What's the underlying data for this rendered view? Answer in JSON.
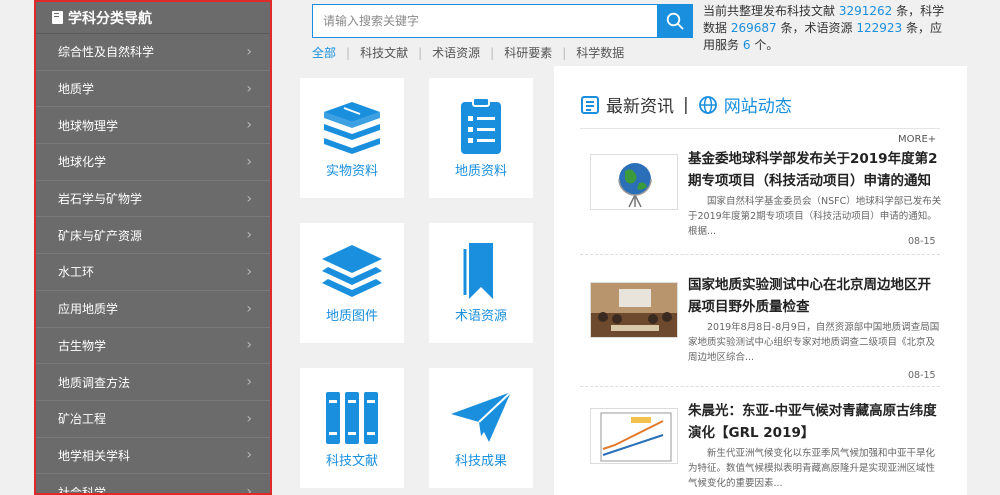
{
  "sidebar": {
    "title": "学科分类导航",
    "items": [
      {
        "label": "综合性及自然科学"
      },
      {
        "label": "地质学"
      },
      {
        "label": "地球物理学"
      },
      {
        "label": "地球化学"
      },
      {
        "label": "岩石学与矿物学"
      },
      {
        "label": "矿床与矿产资源"
      },
      {
        "label": "水工环"
      },
      {
        "label": "应用地质学"
      },
      {
        "label": "古生物学"
      },
      {
        "label": "地质调查方法"
      },
      {
        "label": "矿冶工程"
      },
      {
        "label": "地学相关学科"
      },
      {
        "label": "社会科学"
      }
    ]
  },
  "search": {
    "placeholder": "请输入搜索关键字",
    "filters": [
      "全部",
      "科技文献",
      "术语资源",
      "科研要素",
      "科学数据"
    ],
    "active_filter": "全部"
  },
  "stats": {
    "prefix": "当前共整理发布科技文献",
    "docs": "3291262",
    "mid1": "条，科学数据",
    "data": "269687",
    "mid2": "条，术语资源",
    "terms": "122923",
    "mid3": "条，应用服务",
    "services": "6",
    "suffix": "个。"
  },
  "cards": [
    {
      "label": "实物资料",
      "icon": "books-stack-icon"
    },
    {
      "label": "地质资料",
      "icon": "clipboard-icon"
    },
    {
      "label": "地质图件",
      "icon": "layers-icon"
    },
    {
      "label": "术语资源",
      "icon": "bookmark-icon"
    },
    {
      "label": "科技文献",
      "icon": "book-spines-icon"
    },
    {
      "label": "科技成果",
      "icon": "paper-plane-icon"
    }
  ],
  "news": {
    "tab_latest": "最新资讯",
    "tab_site": "网站动态",
    "more": "MORE+",
    "items": [
      {
        "title": "基金委地球科学部发布关于2019年度第2期专项项目（科技活动项目）申请的通知",
        "desc": "国家自然科学基金委员会（NSFC）地球科学部已发布关于2019年度第2期专项项目（科技活动项目）申请的通知。　　根据...",
        "date": "08-15"
      },
      {
        "title": "国家地质实验测试中心在北京周边地区开展项目野外质量检查",
        "desc": "2019年8月8日-8月9日，自然资源部中国地质调查局国家地质实验测试中心组织专家对地质调查二级项目《北京及周边地区综合...",
        "date": "08-15"
      },
      {
        "title": "朱晨光：东亚-中亚气候对青藏高原古纬度演化【GRL 2019】",
        "desc": "新生代亚洲气候变化以东亚季风气候加强和中亚干旱化为特征。数值气候模拟表明青藏高原隆升是实现亚洲区域性气候变化的重要因素...",
        "date": ""
      }
    ]
  },
  "colors": {
    "accent": "#1a8fde",
    "sidebar_bg": "#6b6b6b",
    "sidebar_border": "#e02a2a"
  }
}
